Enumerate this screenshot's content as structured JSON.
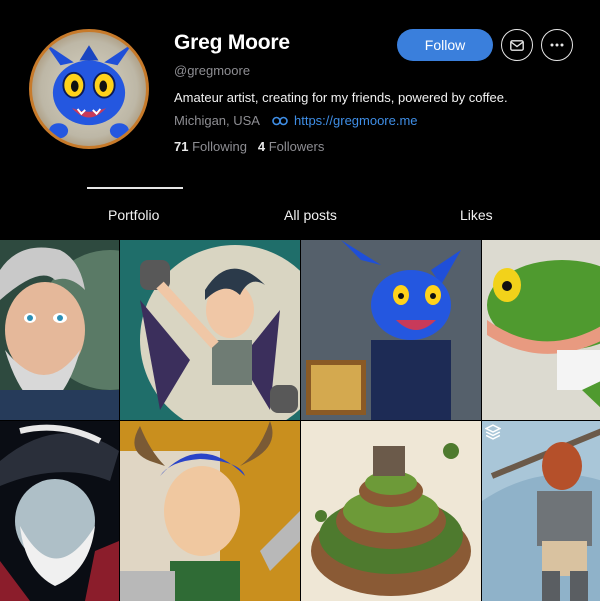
{
  "profile": {
    "name": "Greg Moore",
    "handle": "@gregmoore",
    "bio": "Amateur artist, creating for my friends, powered by coffee.",
    "location": "Michigan, USA",
    "website": "https://gregmoore.me",
    "following_count": "71",
    "following_label": "Following",
    "followers_count": "4",
    "followers_label": "Followers",
    "avatar_icon": "blue-dragon-avatar"
  },
  "actions": {
    "follow_label": "Follow",
    "message_icon": "envelope-icon",
    "more_icon": "ellipsis-icon"
  },
  "tabs": [
    {
      "label": "Portfolio",
      "active": true
    },
    {
      "label": "All posts",
      "active": false
    },
    {
      "label": "Likes",
      "active": false
    }
  ],
  "colors": {
    "background": "#000000",
    "accent": "#3a7fdc",
    "link": "#3f8ee6",
    "muted": "#8e8e93"
  },
  "gallery": [
    {
      "subject": "old-wizard-portrait"
    },
    {
      "subject": "winged-elf-warrior"
    },
    {
      "subject": "blue-dragon-reading"
    },
    {
      "subject": "green-lizard-character"
    },
    {
      "subject": "pirate-captain-portrait"
    },
    {
      "subject": "horned-knight-portrait"
    },
    {
      "subject": "spiral-terraced-landscape"
    },
    {
      "subject": "armored-masked-warrior",
      "multi_image": true
    }
  ]
}
